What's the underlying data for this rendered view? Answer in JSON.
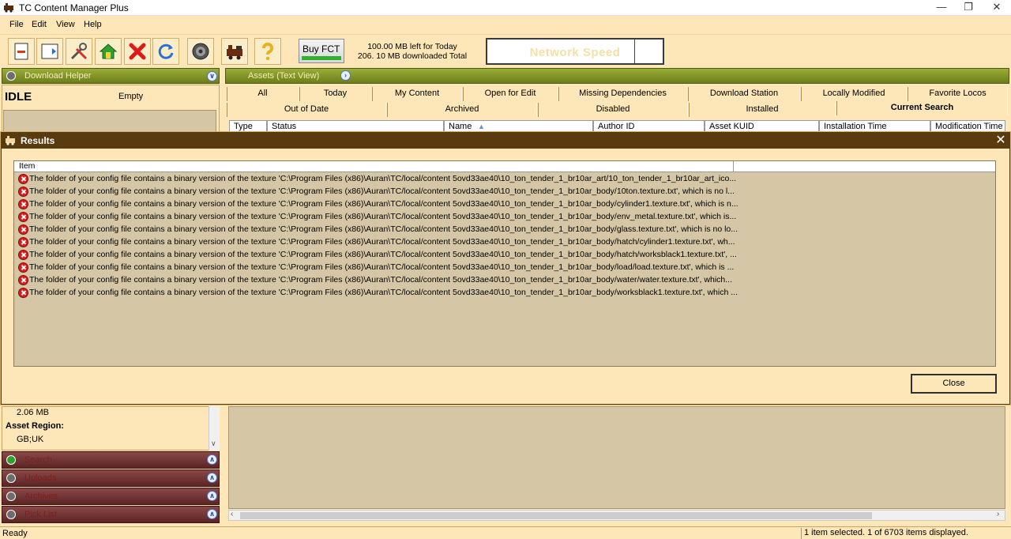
{
  "window": {
    "title": "TC Content Manager Plus"
  },
  "menu": [
    "File",
    "Edit",
    "View",
    "Help"
  ],
  "toolbar": {
    "icons": [
      "new-asset-icon",
      "import-icon",
      "tools-icon",
      "home-icon",
      "delete-icon",
      "refresh-icon",
      "settings-icon",
      "train-icon",
      "help-icon"
    ],
    "buy_label": "Buy FCT",
    "quota_left": "100.00 MB left for Today",
    "quota_total": "206. 10 MB downloaded Total",
    "network_speed": "Network Speed"
  },
  "left_panel": {
    "header": "Download Helper",
    "state": "IDLE",
    "state_detail": "Empty",
    "size_value": "2.06 MB",
    "region_label": "Asset Region:",
    "region_value": "GB;UK",
    "accordions": [
      "Search",
      "Uploads",
      "Archives",
      "Pick List"
    ]
  },
  "right_panel": {
    "header": "Assets (Text View)",
    "tabs_row1": [
      "All",
      "Today",
      "My Content",
      "Open for Edit",
      "Missing Dependencies",
      "Download Station",
      "Locally Modified",
      "Favorite Locos"
    ],
    "tabs_row2": [
      "Out of Date",
      "Archived",
      "Disabled",
      "Installed",
      "Current Search"
    ],
    "columns": [
      "Type",
      "Status",
      "Name",
      "Author ID",
      "Asset KUID",
      "Installation Time",
      "Modification Time"
    ]
  },
  "dialog": {
    "title": "Results",
    "column": "Item",
    "rows": [
      "The folder of your config file contains a binary version of the texture 'C:\\Program Files (x86)\\Auran\\TC/local/content 5ovd33ae40\\10_ton_tender_1_br10ar_art/10_ton_tender_1_br10ar_art_ico...",
      "The folder of your config file contains a binary version of the texture 'C:\\Program Files (x86)\\Auran\\TC/local/content 5ovd33ae40\\10_ton_tender_1_br10ar_body/10ton.texture.txt', which is no l...",
      "The folder of your config file contains a binary version of the texture 'C:\\Program Files (x86)\\Auran\\TC/local/content 5ovd33ae40\\10_ton_tender_1_br10ar_body/cylinder1.texture.txt', which is n...",
      "The folder of your config file contains a binary version of the texture 'C:\\Program Files (x86)\\Auran\\TC/local/content 5ovd33ae40\\10_ton_tender_1_br10ar_body/env_metal.texture.txt', which is...",
      "The folder of your config file contains a binary version of the texture 'C:\\Program Files (x86)\\Auran\\TC/local/content 5ovd33ae40\\10_ton_tender_1_br10ar_body/glass.texture.txt', which is no lo...",
      "The folder of your config file contains a binary version of the texture 'C:\\Program Files (x86)\\Auran\\TC/local/content 5ovd33ae40\\10_ton_tender_1_br10ar_body/hatch/cylinder1.texture.txt', wh...",
      "The folder of your config file contains a binary version of the texture 'C:\\Program Files (x86)\\Auran\\TC/local/content 5ovd33ae40\\10_ton_tender_1_br10ar_body/hatch/worksblack1.texture.txt', ...",
      "The folder of your config file contains a binary version of the texture 'C:\\Program Files (x86)\\Auran\\TC/local/content 5ovd33ae40\\10_ton_tender_1_br10ar_body/load/load.texture.txt', which is ...",
      "The folder of your config file contains a binary version of the texture 'C:\\Program Files (x86)\\Auran\\TC/local/content 5ovd33ae40\\10_ton_tender_1_br10ar_body/water/water.texture.txt', which...",
      "The folder of your config file contains a binary version of the texture 'C:\\Program Files (x86)\\Auran\\TC/local/content 5ovd33ae40\\10_ton_tender_1_br10ar_body/worksblack1.texture.txt', which ..."
    ],
    "close_label": "Close"
  },
  "statusbar": {
    "left": "Ready",
    "right": "1 item selected. 1 of 6703 items displayed."
  }
}
